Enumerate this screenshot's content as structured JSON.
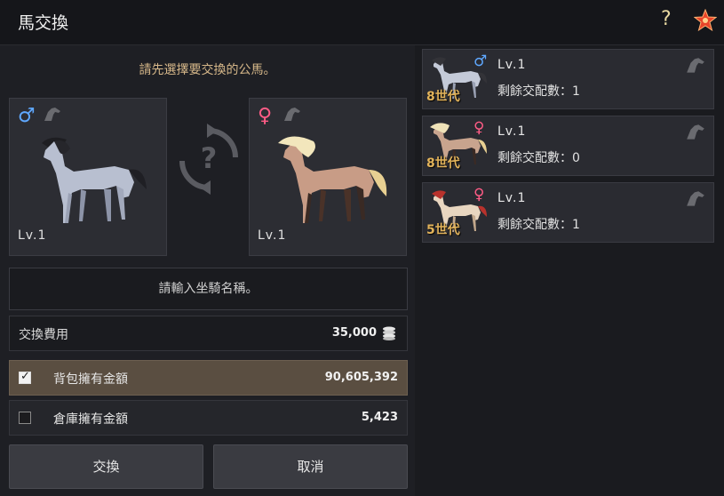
{
  "window": {
    "title": "馬交換"
  },
  "header_icons": [
    "help-icon",
    "star-icon"
  ],
  "instruction": "請先選擇要交換的公馬。",
  "slots": {
    "male": {
      "gender_symbol": "♂",
      "level": "Lv.1"
    },
    "female": {
      "gender_symbol": "♀",
      "level": "Lv.1"
    }
  },
  "swap_symbol": "?",
  "name_input": {
    "placeholder": "請輸入坐騎名稱。"
  },
  "fee": {
    "label": "交換費用",
    "value": "35,000"
  },
  "payment": [
    {
      "label": "背包擁有金額",
      "value": "90,605,392",
      "checked": true,
      "check_symbol": "✓"
    },
    {
      "label": "倉庫擁有金額",
      "value": "5,423",
      "checked": false
    }
  ],
  "buttons": {
    "exchange": "交換",
    "cancel": "取消"
  },
  "horse_list": [
    {
      "gender_symbol": "♂",
      "level": "Lv.1",
      "generation": "8世代",
      "breeding": "剩餘交配數：1",
      "coat": "#c4cad8",
      "mane": "#333338"
    },
    {
      "gender_symbol": "♀",
      "level": "Lv.1",
      "generation": "8世代",
      "breeding": "剩餘交配數：0",
      "coat": "#c8a48e",
      "mane": "#efe2b8"
    },
    {
      "gender_symbol": "♀",
      "level": "Lv.1",
      "generation": "5世代",
      "breeding": "剩餘交配數：1",
      "coat": "#e8d6c0",
      "mane": "#b8322c"
    }
  ],
  "colors": {
    "accent_text": "#d7b88a",
    "male": "#5fa8ff",
    "female": "#ff5c86",
    "generation": "#e2b35a"
  }
}
